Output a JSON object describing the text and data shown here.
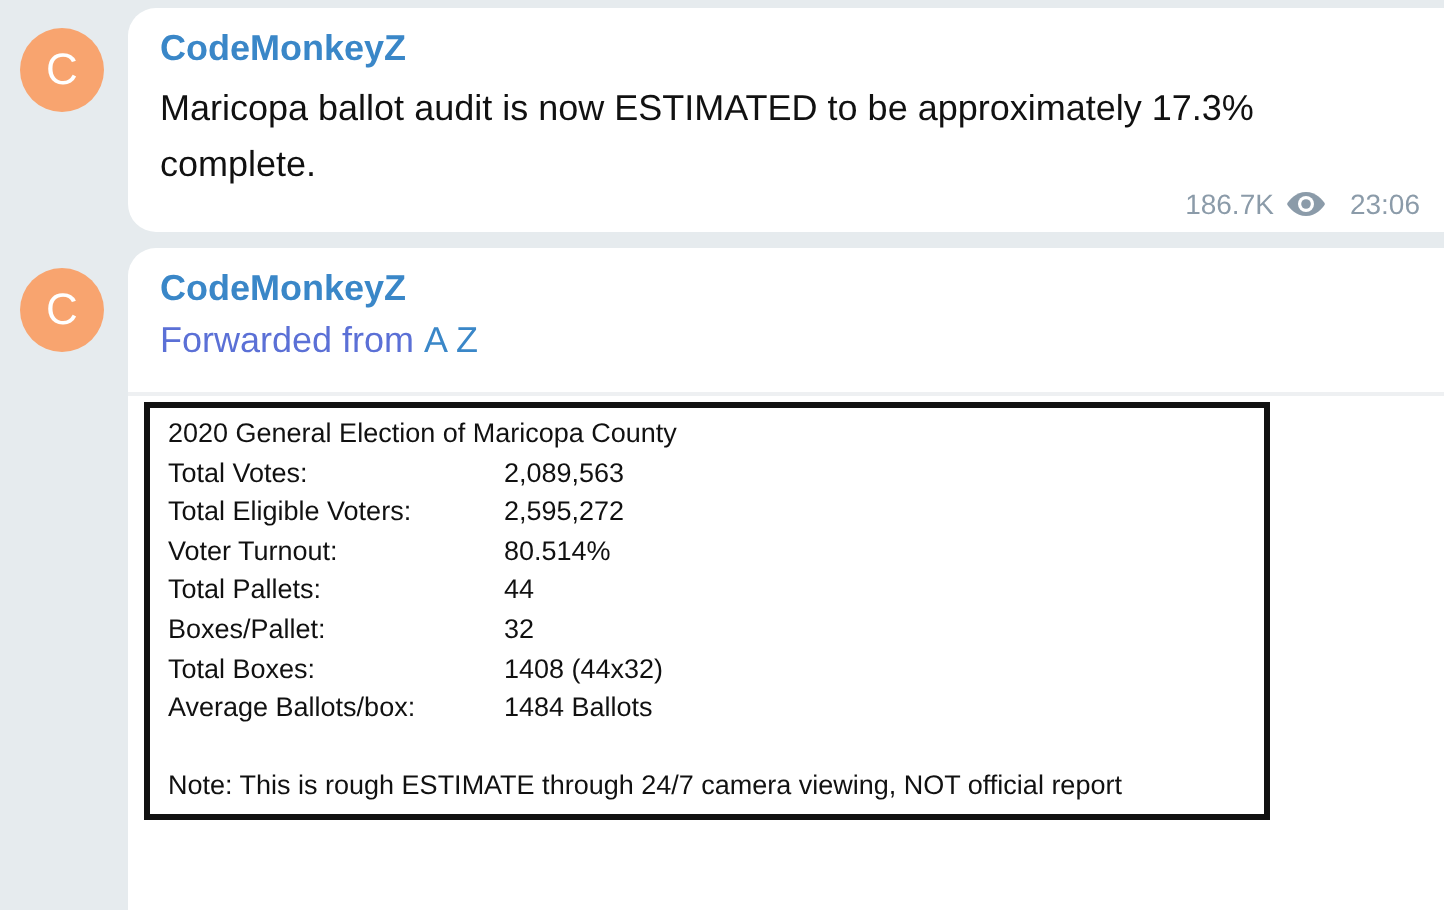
{
  "messages": [
    {
      "avatar_letter": "C",
      "author": "CodeMonkeyZ",
      "text": "Maricopa ballot audit is now ESTIMATED to be approximately 17.3% complete.",
      "views": "186.7K",
      "time": "23:06"
    },
    {
      "avatar_letter": "C",
      "author": "CodeMonkeyZ",
      "forwarded_label": "Forwarded from",
      "forwarded_from": "A Z",
      "document": {
        "title": "2020 General Election of Maricopa County",
        "rows": [
          {
            "label": "Total Votes:",
            "value": "2,089,563"
          },
          {
            "label": "Total Eligible Voters:",
            "value": "2,595,272"
          },
          {
            "label": "Voter Turnout:",
            "value": "80.514%"
          },
          {
            "label": "Total Pallets:",
            "value": "44"
          },
          {
            "label": "Boxes/Pallet:",
            "value": "32"
          },
          {
            "label": "Total Boxes:",
            "value": "1408 (44x32)"
          },
          {
            "label": "Average Ballots/box:",
            "value": "1484 Ballots"
          }
        ],
        "note": "Note: This is rough ESTIMATE through 24/7 camera viewing, NOT official report"
      }
    }
  ]
}
